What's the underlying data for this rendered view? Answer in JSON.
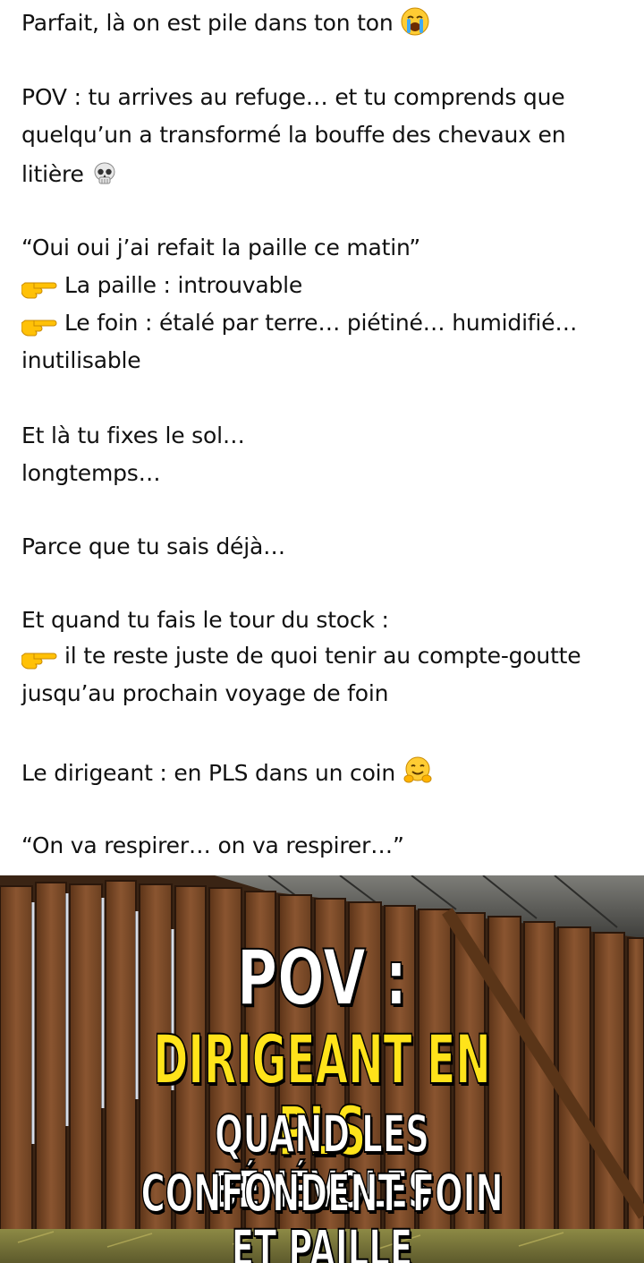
{
  "post": {
    "lines": [
      "Parfait, là on est pile dans ton ton",
      "POV : tu arrives au refuge… et tu comprends que",
      "quelqu’un a transformé la bouffe des chevaux en",
      "litière",
      "“Oui oui j’ai refait la paille ce matin”",
      "La paille : introuvable",
      "Le foin : étalé par terre… piétiné… humidifié…",
      "inutilisable",
      "Et là tu fixes le sol…",
      "longtemps…",
      "Parce que tu sais déjà…",
      "Et quand tu fais le tour du stock :",
      "il te reste juste de quoi tenir au compte-goutte",
      "jusqu’au prochain voyage de foin",
      "Le dirigeant : en PLS dans un coin",
      "“On va respirer… on va respirer…”"
    ],
    "emojis": {
      "line1": "loudly-crying-face-icon",
      "line4": "skull-icon",
      "pointers": "backhand-index-pointing-right-icon",
      "line15": "hugging-face-icon"
    }
  },
  "image": {
    "headline": "POV :",
    "subhead": "DIRIGEANT EN PLS",
    "caption_line1": "QUAND LES BÉNÉVOLES",
    "caption_line2": "CONFONDENT FOIN ET PAILLE",
    "colors": {
      "headline": "#ffffff",
      "subhead": "#ffe31a",
      "wood": "#7a4a26"
    }
  }
}
